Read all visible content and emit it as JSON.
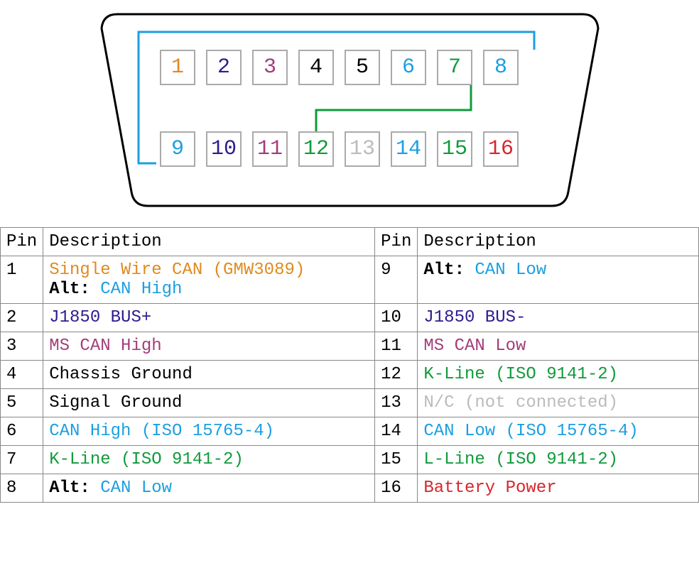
{
  "table_headers": {
    "pin": "Pin",
    "desc": "Description"
  },
  "pins": {
    "1": {
      "num": "1",
      "color": "c-orange"
    },
    "2": {
      "num": "2",
      "color": "c-purple"
    },
    "3": {
      "num": "3",
      "color": "c-magenta"
    },
    "4": {
      "num": "4",
      "color": "c-black"
    },
    "5": {
      "num": "5",
      "color": "c-black"
    },
    "6": {
      "num": "6",
      "color": "c-blue"
    },
    "7": {
      "num": "7",
      "color": "c-green"
    },
    "8": {
      "num": "8",
      "color": "c-blue"
    },
    "9": {
      "num": "9",
      "color": "c-blue"
    },
    "10": {
      "num": "10",
      "color": "c-purple"
    },
    "11": {
      "num": "11",
      "color": "c-magenta"
    },
    "12": {
      "num": "12",
      "color": "c-green"
    },
    "13": {
      "num": "13",
      "color": "c-grey"
    },
    "14": {
      "num": "14",
      "color": "c-blue"
    },
    "15": {
      "num": "15",
      "color": "c-green"
    },
    "16": {
      "num": "16",
      "color": "c-red"
    }
  },
  "rows": [
    {
      "leftPin": "1",
      "left": [
        {
          "text": "Single Wire CAN (GMW3089)",
          "cls": "c-orange"
        },
        {
          "text": "Alt: ",
          "cls": "bold",
          "sameline_break_before": true
        },
        {
          "text": "CAN High",
          "cls": "c-blue"
        }
      ],
      "rightPin": "9",
      "right": [
        {
          "text": "Alt: ",
          "cls": "bold"
        },
        {
          "text": "CAN Low",
          "cls": "c-blue"
        }
      ]
    },
    {
      "leftPin": "2",
      "left": [
        {
          "text": "J1850 BUS+",
          "cls": "c-purple"
        }
      ],
      "rightPin": "10",
      "right": [
        {
          "text": "J1850 BUS-",
          "cls": "c-purple"
        }
      ]
    },
    {
      "leftPin": "3",
      "left": [
        {
          "text": "MS CAN High",
          "cls": "c-magenta"
        }
      ],
      "rightPin": "11",
      "right": [
        {
          "text": "MS CAN Low",
          "cls": "c-magenta"
        }
      ]
    },
    {
      "leftPin": "4",
      "left": [
        {
          "text": "Chassis Ground",
          "cls": "c-black"
        }
      ],
      "rightPin": "12",
      "right": [
        {
          "text": "K-Line (ISO 9141-2)",
          "cls": "c-green"
        }
      ]
    },
    {
      "leftPin": "5",
      "left": [
        {
          "text": "Signal Ground",
          "cls": "c-black"
        }
      ],
      "rightPin": "13",
      "right": [
        {
          "text": "N/C (not connected)",
          "cls": "c-grey"
        }
      ]
    },
    {
      "leftPin": "6",
      "left": [
        {
          "text": "CAN High (ISO 15765-4)",
          "cls": "c-blue"
        }
      ],
      "rightPin": "14",
      "right": [
        {
          "text": "CAN Low (ISO 15765-4)",
          "cls": "c-blue"
        }
      ]
    },
    {
      "leftPin": "7",
      "left": [
        {
          "text": "K-Line (ISO 9141-2)",
          "cls": "c-green"
        }
      ],
      "rightPin": "15",
      "right": [
        {
          "text": "L-Line (ISO 9141-2)",
          "cls": "c-green"
        }
      ]
    },
    {
      "leftPin": "8",
      "left": [
        {
          "text": "Alt: ",
          "cls": "bold"
        },
        {
          "text": "CAN Low",
          "cls": "c-blue"
        }
      ],
      "rightPin": "16",
      "right": [
        {
          "text": "Battery Power",
          "cls": "c-red"
        }
      ]
    }
  ],
  "connections": [
    {
      "from": 8,
      "to": 9,
      "color": "#1b9fe0",
      "note": "CAN Low alt link"
    },
    {
      "from": 7,
      "to": 12,
      "color": "#119a3c",
      "note": "K-Line link"
    }
  ]
}
